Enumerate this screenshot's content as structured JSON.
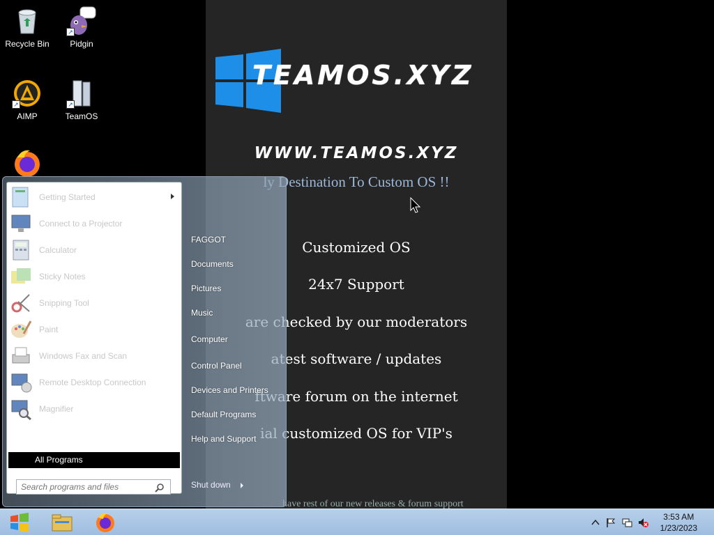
{
  "desktop": {
    "icons": [
      {
        "label": "Recycle Bin"
      },
      {
        "label": "Pidgin"
      },
      {
        "label": "AIMP"
      },
      {
        "label": "TeamOS"
      },
      {
        "label": ""
      }
    ]
  },
  "wallpaper": {
    "brand": "TEAMOS.XYZ",
    "url": "WWW.TEAMOS.XYZ",
    "tagline": "ly Destination To Custom OS !!",
    "features": [
      "Customized OS",
      "24x7 Support",
      "are checked by our moderators",
      "atest software / updates",
      "ftware forum on the internet",
      "ial customized OS for VIP's"
    ],
    "footer": "have rest of our new releases & forum support"
  },
  "start_menu": {
    "programs": [
      {
        "label": "Getting Started",
        "icon": "getting-started-icon",
        "submenu": true
      },
      {
        "label": "Connect to a Projector",
        "icon": "projector-icon"
      },
      {
        "label": "Calculator",
        "icon": "calculator-icon"
      },
      {
        "label": "Sticky Notes",
        "icon": "sticky-notes-icon"
      },
      {
        "label": "Snipping Tool",
        "icon": "snipping-tool-icon"
      },
      {
        "label": "Paint",
        "icon": "paint-icon"
      },
      {
        "label": "Windows Fax and Scan",
        "icon": "fax-scan-icon"
      },
      {
        "label": "Remote Desktop Connection",
        "icon": "remote-desktop-icon"
      },
      {
        "label": "Magnifier",
        "icon": "magnifier-icon"
      }
    ],
    "all_programs": "All Programs",
    "search_placeholder": "Search programs and files",
    "right_items": [
      "FAGGOT",
      "Documents",
      "Pictures",
      "Music",
      "Computer",
      "Control Panel",
      "Devices and Printers",
      "Default Programs",
      "Help and Support"
    ],
    "shutdown": "Shut down"
  },
  "taskbar": {
    "time": "3:53 AM",
    "date": "1/23/2023"
  },
  "colors": {
    "accent": "#1e90ff",
    "taskbar": "#a9c5e6",
    "wallpaper": "#252525"
  }
}
